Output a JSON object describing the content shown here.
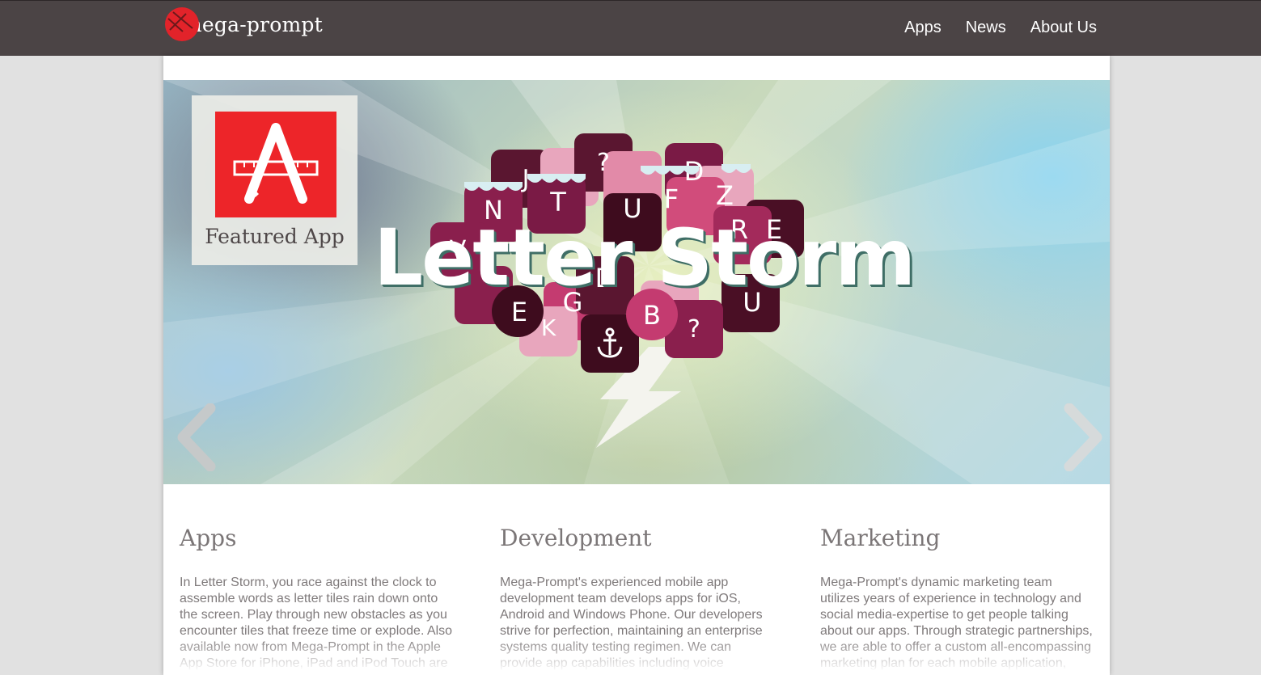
{
  "brand": {
    "name": "mega-prompt",
    "logo_icon": "mega-prompt-logo-icon",
    "accent": "#e2232a"
  },
  "nav": {
    "items": [
      {
        "label": "Apps"
      },
      {
        "label": "News"
      },
      {
        "label": "About Us"
      }
    ]
  },
  "hero": {
    "title": "Letter Storm",
    "featured_label": "Featured App",
    "featured_icon": "letter-a-paintbrush-icon",
    "prev_icon": "chevron-left-icon",
    "next_icon": "chevron-right-icon",
    "tile_letters": [
      "N",
      "T",
      "U",
      "F",
      "D",
      "Z",
      "E",
      "R",
      "?",
      "E",
      "G",
      "B",
      "U",
      "?",
      "K",
      "D",
      "V",
      "J"
    ]
  },
  "sections": [
    {
      "title": "Apps",
      "body": "In Letter Storm, you race against the clock to assemble words as letter tiles rain down onto the screen. Play through new obstacles as you encounter tiles that freeze time or explode. Also available now from Mega-Prompt in the Apple App Store for iPhone, iPad and iPod Touch are Mega Bee and Bunny Dash."
    },
    {
      "title": "Development",
      "body": "Mega-Prompt's experienced mobile app development team develops apps for iOS, Android and Windows Phone. Our developers strive for perfection, maintaining an enterprise systems quality testing regimen. We can provide app capabilities including voice recognition, GPS and mapping functions."
    },
    {
      "title": "Marketing",
      "body": "Mega-Prompt's dynamic marketing team utilizes years of experience in technology and social media-expertise to get people talking about our apps. Through strategic partnerships, we are able to offer a custom all-encompassing marketing plan for each mobile application, providing everything from graphics."
    }
  ]
}
